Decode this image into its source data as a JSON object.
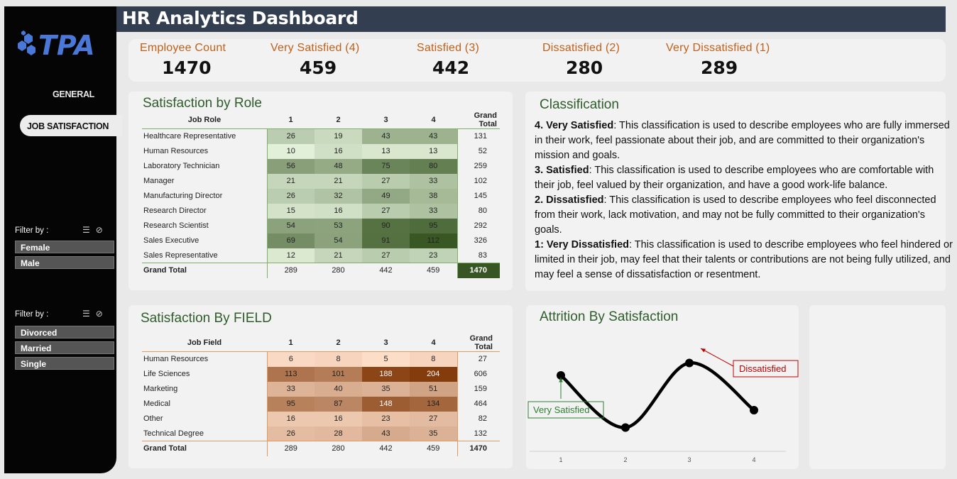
{
  "header": {
    "title": "HR Analytics Dashboard"
  },
  "sidebar": {
    "logo_text": "TPA",
    "nav": {
      "general": "GENERAL",
      "job_satisfaction": "JOB SATISFACTION"
    },
    "filter1": {
      "label": "Filter by :",
      "options": [
        "Female",
        "Male"
      ]
    },
    "filter2": {
      "label": "Filter by :",
      "options": [
        "Divorced",
        "Married",
        "Single"
      ]
    }
  },
  "kpis": [
    {
      "label": "Employee Count",
      "value": "1470"
    },
    {
      "label": "Very Satisfied (4)",
      "value": "459"
    },
    {
      "label": "Satisfied (3)",
      "value": "442"
    },
    {
      "label": "Dissatisfied (2)",
      "value": "280"
    },
    {
      "label": "Very Dissatisfied (1)",
      "value": "289"
    }
  ],
  "role_table": {
    "title": "Satisfaction by Role",
    "headers": [
      "Job Role",
      "1",
      "2",
      "3",
      "4",
      "Grand Total"
    ],
    "rows": [
      {
        "label": "Healthcare Representative",
        "values": [
          "26",
          "19",
          "43",
          "43"
        ],
        "total": "131"
      },
      {
        "label": "Human Resources",
        "values": [
          "10",
          "16",
          "13",
          "13"
        ],
        "total": "52"
      },
      {
        "label": "Laboratory Technician",
        "values": [
          "56",
          "48",
          "75",
          "80"
        ],
        "total": "259"
      },
      {
        "label": "Manager",
        "values": [
          "21",
          "21",
          "27",
          "33"
        ],
        "total": "102"
      },
      {
        "label": "Manufacturing Director",
        "values": [
          "26",
          "32",
          "49",
          "38"
        ],
        "total": "145"
      },
      {
        "label": "Research Director",
        "values": [
          "15",
          "16",
          "27",
          "33"
        ],
        "total": "80"
      },
      {
        "label": "Research Scientist",
        "values": [
          "54",
          "53",
          "90",
          "95"
        ],
        "total": "292"
      },
      {
        "label": "Sales Executive",
        "values": [
          "69",
          "54",
          "91",
          "112"
        ],
        "total": "326"
      },
      {
        "label": "Sales Representative",
        "values": [
          "12",
          "21",
          "27",
          "23"
        ],
        "total": "83"
      }
    ],
    "total_row": {
      "label": "Grand Total",
      "values": [
        "289",
        "280",
        "442",
        "459"
      ],
      "total": "1470"
    }
  },
  "field_table": {
    "title": "Satisfaction By FIELD",
    "headers": [
      "Job Field",
      "1",
      "2",
      "3",
      "4",
      "Grand Total"
    ],
    "rows": [
      {
        "label": "Human Resources",
        "values": [
          "6",
          "8",
          "5",
          "8"
        ],
        "total": "27"
      },
      {
        "label": "Life Sciences",
        "values": [
          "113",
          "101",
          "188",
          "204"
        ],
        "total": "606"
      },
      {
        "label": "Marketing",
        "values": [
          "33",
          "40",
          "35",
          "51"
        ],
        "total": "159"
      },
      {
        "label": "Medical",
        "values": [
          "95",
          "87",
          "148",
          "134"
        ],
        "total": "464"
      },
      {
        "label": "Other",
        "values": [
          "16",
          "16",
          "23",
          "27"
        ],
        "total": "82"
      },
      {
        "label": "Technical Degree",
        "values": [
          "26",
          "28",
          "43",
          "35"
        ],
        "total": "132"
      }
    ],
    "total_row": {
      "label": "Grand Total",
      "values": [
        "289",
        "280",
        "442",
        "459"
      ],
      "total": "1470"
    }
  },
  "classification": {
    "title": "Classification",
    "items": [
      {
        "head": "4. Very Satisfied",
        "text": ": This classification is used to describe employees who are fully immersed in their work, feel passionate about their job, and are committed to their organization's mission and goals."
      },
      {
        "head": "3. Satisfied",
        "text": ": This classification is used to describe employees who are comfortable with their job, feel valued by their organization, and have a good work-life balance."
      },
      {
        "head": "2. Dissatisfied",
        "text": ": This classification is used to describe employees who feel disconnected from their work, lack motivation, and may not be fully committed to their organization's goals."
      },
      {
        "head": "1: Very Dissatisfied",
        "text": ": This classification is used to describe employees who feel hindered or limited in their job, may feel that their talents or contributions are not being fully utilized, and may feel a sense of dissatisfaction or resentment."
      }
    ]
  },
  "chart_data": {
    "type": "line",
    "title": "Attrition By Satisfaction",
    "categories": [
      "1",
      "2",
      "3",
      "4"
    ],
    "values": [
      66,
      45,
      71,
      52
    ],
    "ylim": [
      40,
      80
    ],
    "annotations": [
      {
        "text": "Very Satisfied",
        "point": 1,
        "color": "#2e7d32"
      },
      {
        "text": "Dissatisfied",
        "point": 3,
        "color": "#c00000"
      }
    ]
  },
  "colors": {
    "header": "#333f50",
    "role_accent": "#548235",
    "field_accent": "#c55a11",
    "kpi_label": "#c0601a"
  }
}
